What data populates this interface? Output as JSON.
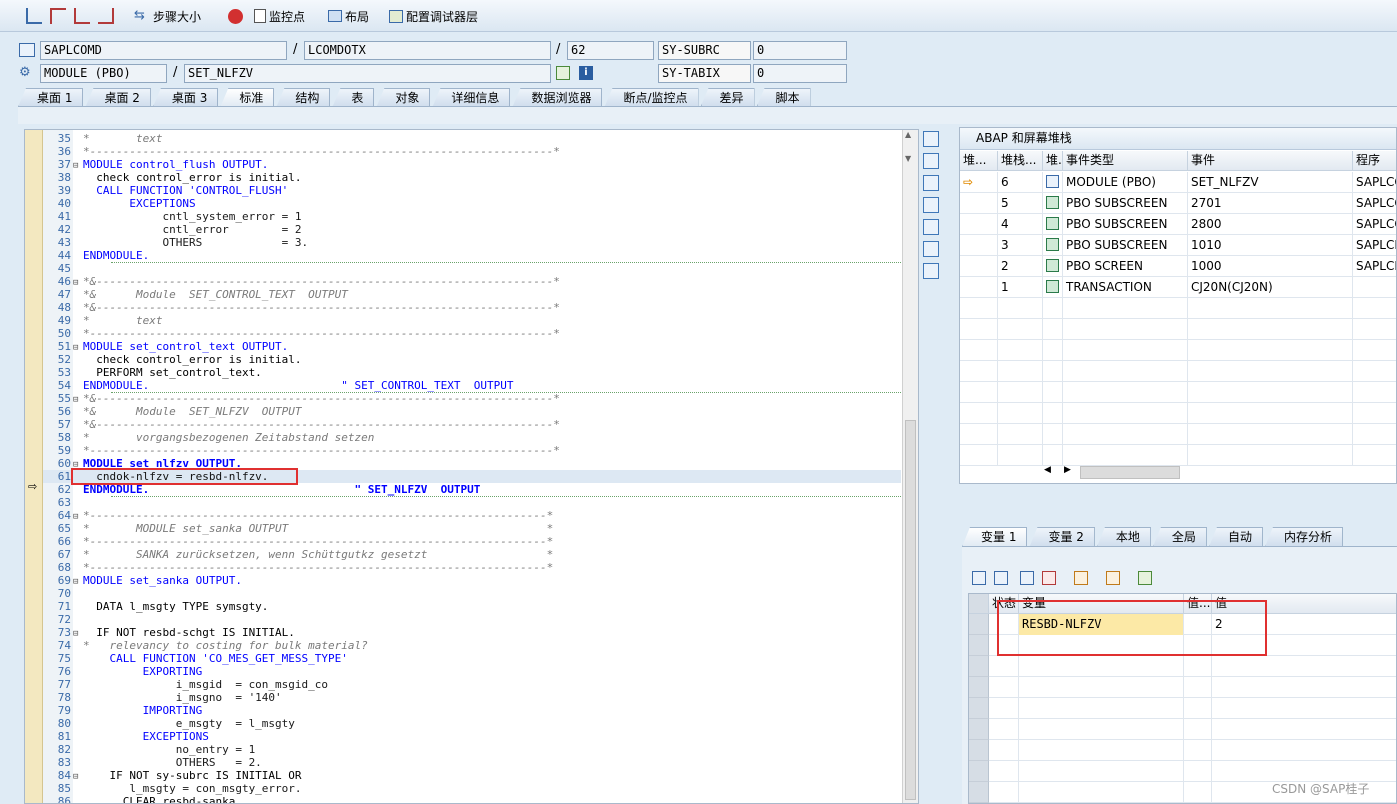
{
  "toolbar": {
    "step_size": "步骤大小",
    "watchpoint": "监控点",
    "layout": "布局",
    "config_layer": "配置调试器层"
  },
  "header": {
    "program": "SAPLCOMD",
    "include": "LCOMDOTX",
    "line": "62",
    "sy_subrc_label": "SY-SUBRC",
    "sy_subrc_value": "0",
    "event_type": "MODULE (PBO)",
    "event": "SET_NLFZV",
    "sy_tabix_label": "SY-TABIX",
    "sy_tabix_value": "0",
    "slash": "/"
  },
  "main_tabs": [
    "桌面 1",
    "桌面 2",
    "桌面 3",
    "标准",
    "结构",
    "表",
    "对象",
    "详细信息",
    "数据浏览器",
    "断点/监控点",
    "差异",
    "脚本"
  ],
  "code_lines": [
    {
      "n": "35",
      "t": "*       text",
      "c": "cm"
    },
    {
      "n": "36",
      "t": "*----------------------------------------------------------------------*",
      "c": "cm"
    },
    {
      "n": "37",
      "t": "MODULE control_flush OUTPUT.",
      "c": "kw",
      "fold": true
    },
    {
      "n": "38",
      "t": "  check control_error is initial.",
      "c": "mix1"
    },
    {
      "n": "39",
      "t": "  CALL FUNCTION 'CONTROL_FLUSH'",
      "c": "mix2"
    },
    {
      "n": "40",
      "t": "       EXCEPTIONS",
      "c": "kw"
    },
    {
      "n": "41",
      "t": "            cntl_system_error = 1",
      "c": "asg"
    },
    {
      "n": "42",
      "t": "            cntl_error        = 2",
      "c": "asg"
    },
    {
      "n": "43",
      "t": "            OTHERS            = 3.",
      "c": "asg2"
    },
    {
      "n": "44",
      "t": "ENDMODULE.",
      "c": "kw",
      "sep": true
    },
    {
      "n": "45",
      "t": "",
      "c": ""
    },
    {
      "n": "46",
      "t": "*&---------------------------------------------------------------------*",
      "c": "cm",
      "fold": true
    },
    {
      "n": "47",
      "t": "*&      Module  SET_CONTROL_TEXT  OUTPUT",
      "c": "cm"
    },
    {
      "n": "48",
      "t": "*&---------------------------------------------------------------------*",
      "c": "cm"
    },
    {
      "n": "49",
      "t": "*       text",
      "c": "cm"
    },
    {
      "n": "50",
      "t": "*----------------------------------------------------------------------*",
      "c": "cm"
    },
    {
      "n": "51",
      "t": "MODULE set_control_text OUTPUT.",
      "c": "kw",
      "fold": true
    },
    {
      "n": "52",
      "t": "  check control_error is initial.",
      "c": "mix1"
    },
    {
      "n": "53",
      "t": "  PERFORM set_control_text.",
      "c": "mix3"
    },
    {
      "n": "54",
      "t": "ENDMODULE.                             \" SET_CONTROL_TEXT  OUTPUT",
      "c": "endc",
      "sep": true
    },
    {
      "n": "55",
      "t": "*&---------------------------------------------------------------------*",
      "c": "cm",
      "fold": true
    },
    {
      "n": "56",
      "t": "*&      Module  SET_NLFZV  OUTPUT",
      "c": "cm"
    },
    {
      "n": "57",
      "t": "*&---------------------------------------------------------------------*",
      "c": "cm"
    },
    {
      "n": "58",
      "t": "*       vorgangsbezogenen Zeitabstand setzen",
      "c": "cm"
    },
    {
      "n": "59",
      "t": "*----------------------------------------------------------------------*",
      "c": "cm"
    },
    {
      "n": "60",
      "t": "MODULE set_nlfzv OUTPUT.",
      "c": "kwb",
      "fold": true
    },
    {
      "n": "61",
      "t": "  cndok-nlfzv = resbd-nlfzv.",
      "c": "cur"
    },
    {
      "n": "62",
      "t": "ENDMODULE.                               \" SET_NLFZV  OUTPUT",
      "c": "endb",
      "sep": true
    },
    {
      "n": "63",
      "t": "",
      "c": ""
    },
    {
      "n": "64",
      "t": "*---------------------------------------------------------------------*",
      "c": "cm",
      "fold": true
    },
    {
      "n": "65",
      "t": "*       MODULE set_sanka OUTPUT                                       *",
      "c": "cm"
    },
    {
      "n": "66",
      "t": "*---------------------------------------------------------------------*",
      "c": "cm"
    },
    {
      "n": "67",
      "t": "*       SANKA zurücksetzen, wenn Schüttgutkz gesetzt                  *",
      "c": "cm"
    },
    {
      "n": "68",
      "t": "*---------------------------------------------------------------------*",
      "c": "cm"
    },
    {
      "n": "69",
      "t": "MODULE set_sanka OUTPUT.",
      "c": "kw",
      "fold": true
    },
    {
      "n": "70",
      "t": "",
      "c": ""
    },
    {
      "n": "71",
      "t": "  DATA l_msgty TYPE symsgty.",
      "c": "mix4"
    },
    {
      "n": "72",
      "t": "",
      "c": ""
    },
    {
      "n": "73",
      "t": "  IF NOT resbd-schgt IS INITIAL.",
      "c": "mix5",
      "fold": true
    },
    {
      "n": "74",
      "t": "*   relevancy to costing for bulk material?",
      "c": "cm"
    },
    {
      "n": "75",
      "t": "    CALL FUNCTION 'CO_MES_GET_MESS_TYPE'",
      "c": "mix2"
    },
    {
      "n": "76",
      "t": "         EXPORTING",
      "c": "kw"
    },
    {
      "n": "77",
      "t": "              i_msgid  = con_msgid_co",
      "c": "asg3"
    },
    {
      "n": "78",
      "t": "              i_msgno  = '140'",
      "c": "asg4"
    },
    {
      "n": "79",
      "t": "         IMPORTING",
      "c": "kw"
    },
    {
      "n": "80",
      "t": "              e_msgty  = l_msgty",
      "c": "asg3"
    },
    {
      "n": "81",
      "t": "         EXCEPTIONS",
      "c": "kw"
    },
    {
      "n": "82",
      "t": "              no_entry = 1",
      "c": "asg"
    },
    {
      "n": "83",
      "t": "              OTHERS   = 2.",
      "c": "asg2"
    },
    {
      "n": "84",
      "t": "    IF NOT sy-subrc IS INITIAL OR",
      "c": "mix6",
      "fold": true
    },
    {
      "n": "85",
      "t": "       l_msgty = con_msgty_error.",
      "c": "asg3"
    },
    {
      "n": "86",
      "t": "      CLEAR resbd-sanka.",
      "c": "mix7"
    }
  ],
  "stack": {
    "title": "ABAP 和屏幕堆栈",
    "headers": [
      "堆...",
      "堆栈...",
      "堆.",
      "事件类型",
      "事件",
      "程序"
    ],
    "rows": [
      {
        "level": "6",
        "type": "MODULE (PBO)",
        "event": "SET_NLFZV",
        "program": "SAPLCO",
        "current": true
      },
      {
        "level": "5",
        "type": "PBO SUBSCREEN",
        "event": "2701",
        "program": "SAPLCO",
        "current": false
      },
      {
        "level": "4",
        "type": "PBO SUBSCREEN",
        "event": "2800",
        "program": "SAPLCO",
        "current": false
      },
      {
        "level": "3",
        "type": "PBO SUBSCREEN",
        "event": "1010",
        "program": "SAPLCN",
        "current": false
      },
      {
        "level": "2",
        "type": "PBO SCREEN",
        "event": "1000",
        "program": "SAPLCN",
        "current": false
      },
      {
        "level": "1",
        "type": "TRANSACTION",
        "event": "CJ20N(CJ20N)",
        "program": "",
        "current": false
      }
    ]
  },
  "var_tabs": [
    "变量 1",
    "变量 2",
    "本地",
    "全局",
    "自动",
    "内存分析"
  ],
  "var_grid": {
    "headers": [
      "状态",
      "变量",
      "值...",
      "值"
    ],
    "rows": [
      {
        "variable": "RESBD-NLFZV",
        "value": "2"
      }
    ]
  },
  "watermark": "CSDN @SAP桂子"
}
